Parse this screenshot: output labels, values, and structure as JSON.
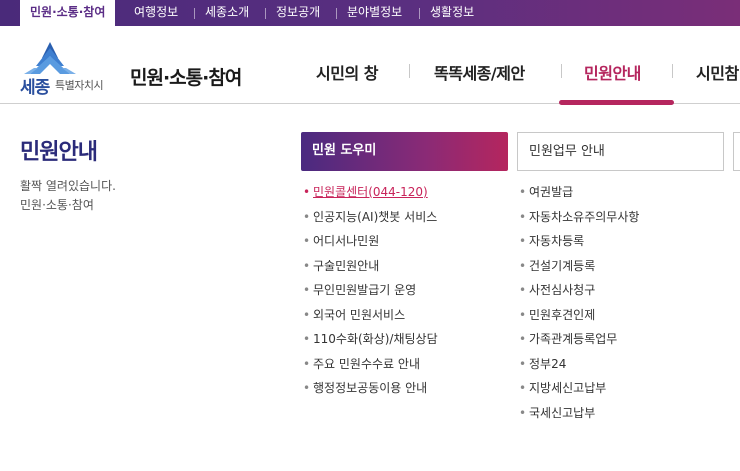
{
  "topbar": {
    "items": [
      "민원·소통·참여",
      "여행정보",
      "세종소개",
      "정보공개",
      "분야별정보",
      "생활정보"
    ]
  },
  "header": {
    "logo_main": "세종",
    "logo_sub": "특별자치시",
    "site_title": "민원·소통·참여",
    "gnb": [
      "시민의 창",
      "똑똑세종/제안",
      "민원안내",
      "시민참"
    ]
  },
  "section": {
    "title": "민원안내",
    "desc_line1": "활짝 열려있습니다.",
    "desc_line2": "민원·소통·참여"
  },
  "panels": {
    "active_label": "민원 도우미",
    "normal_label": "민원업무 안내"
  },
  "left_menu": [
    "민원콜센터(044-120)",
    "인공지능(AI)챗봇 서비스",
    "어디서나민원",
    "구술민원안내",
    "무인민원발급기 운영",
    "외국어 민원서비스",
    "110수화(화상)/채팅상담",
    "주요 민원수수료 안내",
    "행정정보공동이용 안내"
  ],
  "right_menu": [
    "여권발급",
    "자동차소유주의무사항",
    "자동차등록",
    "건설기계등록",
    "사전심사청구",
    "민원후견인제",
    "가족관계등록업무",
    "정부24",
    "지방세신고납부",
    "국세신고납부"
  ],
  "colors": {
    "primary": "#5b2d86",
    "accent": "#b5265e"
  }
}
